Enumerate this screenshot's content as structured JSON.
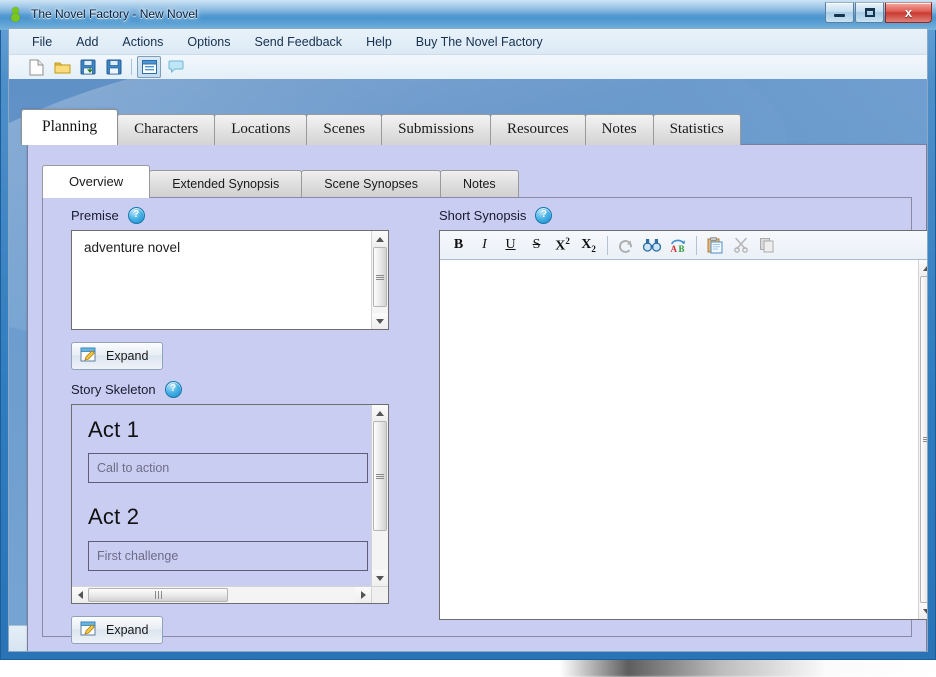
{
  "window": {
    "title": "The Novel Factory - New Novel",
    "app_icon": "novel-factory-icon",
    "minimize_label": "–",
    "maximize_label": "□",
    "close_label": "x"
  },
  "menubar": {
    "items": [
      {
        "label": "File"
      },
      {
        "label": "Add"
      },
      {
        "label": "Actions"
      },
      {
        "label": "Options"
      },
      {
        "label": "Send Feedback"
      },
      {
        "label": "Help"
      },
      {
        "label": "Buy The Novel Factory"
      }
    ]
  },
  "toolbar": {
    "buttons": [
      {
        "icon": "new-document-icon",
        "pressed": false
      },
      {
        "icon": "open-folder-icon",
        "pressed": false
      },
      {
        "icon": "save-as-icon",
        "pressed": false
      },
      {
        "icon": "save-icon",
        "pressed": false
      },
      {
        "icon": "separator",
        "pressed": false
      },
      {
        "icon": "panel-toggle-icon",
        "pressed": true
      },
      {
        "icon": "comment-bubble-icon",
        "pressed": false
      }
    ]
  },
  "main_tabs": {
    "items": [
      {
        "label": "Planning",
        "active": true
      },
      {
        "label": "Characters",
        "active": false
      },
      {
        "label": "Locations",
        "active": false
      },
      {
        "label": "Scenes",
        "active": false
      },
      {
        "label": "Submissions",
        "active": false
      },
      {
        "label": "Resources",
        "active": false
      },
      {
        "label": "Notes",
        "active": false
      },
      {
        "label": "Statistics",
        "active": false
      }
    ]
  },
  "sub_tabs": {
    "items": [
      {
        "label": "Overview",
        "active": true
      },
      {
        "label": "Extended Synopsis",
        "active": false
      },
      {
        "label": "Scene Synopses",
        "active": false
      },
      {
        "label": "Notes",
        "active": false
      }
    ]
  },
  "premise": {
    "label": "Premise",
    "help_glyph": "?",
    "value": "adventure novel",
    "expand_label": "Expand"
  },
  "story_skeleton": {
    "label": "Story Skeleton",
    "help_glyph": "?",
    "acts": [
      {
        "title": "Act 1",
        "placeholder": "Call to action"
      },
      {
        "title": "Act 2",
        "placeholder": "First challenge"
      }
    ],
    "expand_label": "Expand"
  },
  "short_synopsis": {
    "label": "Short Synopsis",
    "help_glyph": "?",
    "value": "",
    "toolbar": [
      {
        "name": "bold-icon",
        "glyph": "B",
        "enabled": true
      },
      {
        "name": "italic-icon",
        "glyph": "I",
        "enabled": true
      },
      {
        "name": "underline-icon",
        "glyph": "U",
        "enabled": true
      },
      {
        "name": "strikethrough-icon",
        "glyph": "S",
        "enabled": true
      },
      {
        "name": "superscript-icon",
        "glyph": "X",
        "enabled": true
      },
      {
        "name": "subscript-icon",
        "glyph": "X",
        "enabled": true
      },
      {
        "name": "undo-icon",
        "glyph": "",
        "enabled": false
      },
      {
        "name": "find-binoculars-icon",
        "glyph": "",
        "enabled": true
      },
      {
        "name": "spellcheck-icon",
        "glyph": "",
        "enabled": true
      },
      {
        "name": "paste-icon",
        "glyph": "",
        "enabled": true
      },
      {
        "name": "cut-scissors-icon",
        "glyph": "",
        "enabled": false
      },
      {
        "name": "copy-icon",
        "glyph": "",
        "enabled": false
      }
    ]
  },
  "colors": {
    "panel_lavender": "#c9cdf2",
    "window_blue": "#6b9ccd",
    "titlebar_blue": "#5fa0d4",
    "close_red": "#c93a31",
    "help_blue": "#1d86c4",
    "accent_green": "#7ac61a"
  }
}
